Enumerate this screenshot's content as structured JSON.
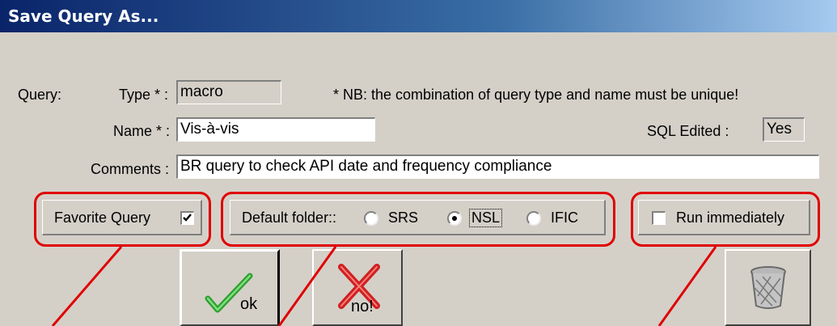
{
  "window": {
    "title": "Save Query As..."
  },
  "form": {
    "query_label": "Query:",
    "type_label": "Type * :",
    "type_value": "macro",
    "nb_text": "* NB:  the combination of query type and name must be unique!",
    "name_label": "Name * :",
    "name_value": "Vis-à-vis",
    "sql_edited_label": "SQL Edited :",
    "sql_edited_value": "Yes",
    "comments_label": "Comments :",
    "comments_value": "BR query to check API date and frequency compliance"
  },
  "options": {
    "favorite_label": "Favorite Query",
    "favorite_checked": true,
    "default_folder_label": "Default folder::",
    "folders": [
      "SRS",
      "NSL",
      "IFIC"
    ],
    "selected_folder": "NSL",
    "run_label": "Run immediately",
    "run_checked": false
  },
  "buttons": {
    "ok_label": "ok",
    "no_label": "no!"
  },
  "colors": {
    "highlight": "#e00000",
    "titlebar_start": "#0a246a",
    "dialog_bg": "#d4d0c8"
  }
}
